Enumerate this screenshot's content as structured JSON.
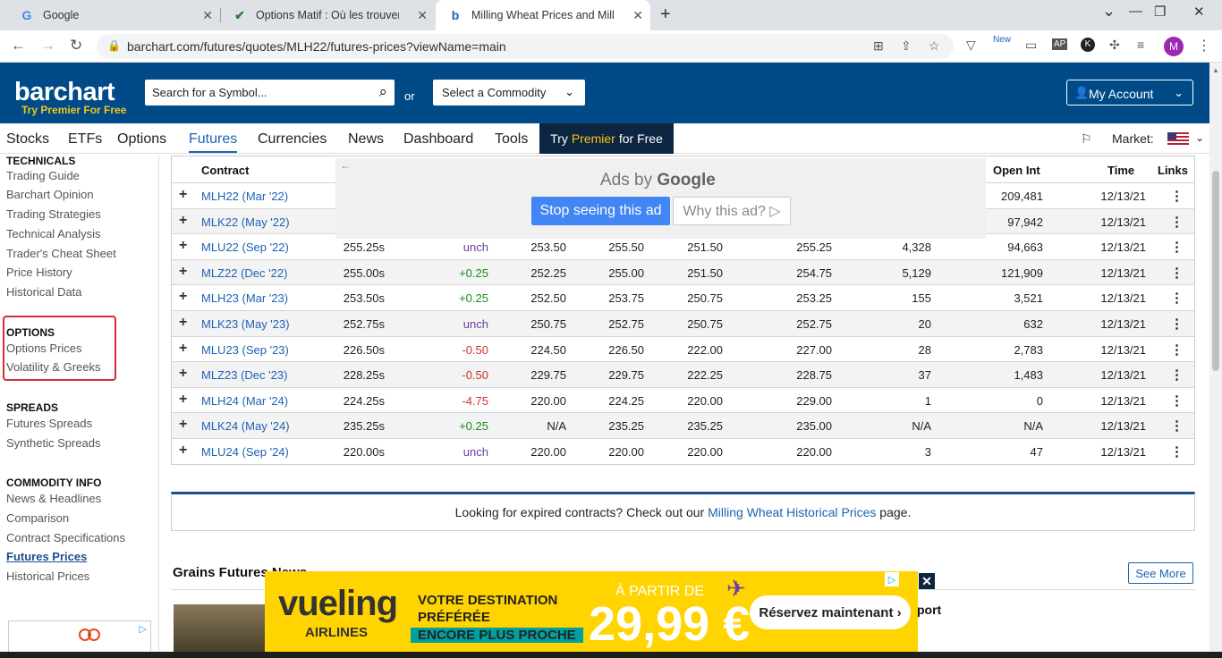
{
  "browser": {
    "tabs": [
      {
        "label": "Google",
        "favicon": "G"
      },
      {
        "label": "Options Matif : Où les trouver? -",
        "favicon": "✔"
      },
      {
        "label": "Milling Wheat Prices and Milling",
        "favicon": "b"
      }
    ],
    "url": "barchart.com/futures/quotes/MLH22/futures-prices?viewName=main",
    "avatar": "M",
    "ext_new_badge": "New",
    "ext_ap": "AP",
    "ext_k": "K"
  },
  "header": {
    "logo": "barchart",
    "premier_tag": "Try Premier For Free",
    "search_placeholder": "Search for a Symbol...",
    "or": "or",
    "commodity_placeholder": "Select a Commodity",
    "account": "My Account"
  },
  "nav": {
    "items": [
      "Stocks",
      "ETFs",
      "Options",
      "Futures",
      "Currencies",
      "News",
      "Dashboard",
      "Tools"
    ],
    "try": "Try",
    "premier": "Premier",
    "for_free": "for Free",
    "market": "Market:"
  },
  "sidebar": {
    "technicals": "TECHNICALS",
    "tech_links": [
      "Trading Guide",
      "Barchart Opinion",
      "Trading Strategies",
      "Technical Analysis",
      "Trader's Cheat Sheet",
      "Price History",
      "Historical Data"
    ],
    "options": "OPTIONS",
    "options_links": [
      "Options Prices",
      "Volatility & Greeks"
    ],
    "spreads": "SPREADS",
    "spreads_links": [
      "Futures Spreads",
      "Synthetic Spreads"
    ],
    "commodity": "COMMODITY INFO",
    "commodity_links": [
      "News & Headlines",
      "Comparison",
      "Contract Specifications",
      "Futures Prices",
      "Historical Prices"
    ],
    "ad_choices": "▷"
  },
  "table": {
    "headers": {
      "contract": "Contract",
      "open_int": "Open Int",
      "time": "Time",
      "links": "Links"
    },
    "rows": [
      {
        "contract": "MLH22 (Mar '22)",
        "last": "",
        "change": "",
        "open": "",
        "high": "",
        "low": "",
        "prev": "",
        "volume": "",
        "open_int": "209,481",
        "time": "12/13/21"
      },
      {
        "contract": "MLK22 (May '22)",
        "last": "",
        "change": "",
        "open": "",
        "high": "",
        "low": "",
        "prev": "",
        "volume": "",
        "open_int": "97,942",
        "time": "12/13/21"
      },
      {
        "contract": "MLU22 (Sep '22)",
        "last": "255.25s",
        "change": "unch",
        "open": "253.50",
        "high": "255.50",
        "low": "251.50",
        "prev": "255.25",
        "volume": "4,328",
        "open_int": "94,663",
        "time": "12/13/21"
      },
      {
        "contract": "MLZ22 (Dec '22)",
        "last": "255.00s",
        "change": "+0.25",
        "open": "252.25",
        "high": "255.00",
        "low": "251.50",
        "prev": "254.75",
        "volume": "5,129",
        "open_int": "121,909",
        "time": "12/13/21"
      },
      {
        "contract": "MLH23 (Mar '23)",
        "last": "253.50s",
        "change": "+0.25",
        "open": "252.50",
        "high": "253.75",
        "low": "250.75",
        "prev": "253.25",
        "volume": "155",
        "open_int": "3,521",
        "time": "12/13/21"
      },
      {
        "contract": "MLK23 (May '23)",
        "last": "252.75s",
        "change": "unch",
        "open": "250.75",
        "high": "252.75",
        "low": "250.75",
        "prev": "252.75",
        "volume": "20",
        "open_int": "632",
        "time": "12/13/21"
      },
      {
        "contract": "MLU23 (Sep '23)",
        "last": "226.50s",
        "change": "-0.50",
        "open": "224.50",
        "high": "226.50",
        "low": "222.00",
        "prev": "227.00",
        "volume": "28",
        "open_int": "2,783",
        "time": "12/13/21"
      },
      {
        "contract": "MLZ23 (Dec '23)",
        "last": "228.25s",
        "change": "-0.50",
        "open": "229.75",
        "high": "229.75",
        "low": "222.25",
        "prev": "228.75",
        "volume": "37",
        "open_int": "1,483",
        "time": "12/13/21"
      },
      {
        "contract": "MLH24 (Mar '24)",
        "last": "224.25s",
        "change": "-4.75",
        "open": "220.00",
        "high": "224.25",
        "low": "220.00",
        "prev": "229.00",
        "volume": "1",
        "open_int": "0",
        "time": "12/13/21"
      },
      {
        "contract": "MLK24 (May '24)",
        "last": "235.25s",
        "change": "+0.25",
        "open": "N/A",
        "high": "235.25",
        "low": "235.25",
        "prev": "235.00",
        "volume": "N/A",
        "open_int": "N/A",
        "time": "12/13/21"
      },
      {
        "contract": "MLU24 (Sep '24)",
        "last": "220.00s",
        "change": "unch",
        "open": "220.00",
        "high": "220.00",
        "low": "220.00",
        "prev": "220.00",
        "volume": "3",
        "open_int": "47",
        "time": "12/13/21"
      }
    ]
  },
  "google_ad": {
    "ads_by": "Ads by",
    "google": "Google",
    "stop": "Stop seeing this ad",
    "why": "Why this ad? ▷"
  },
  "expired": {
    "before": "Looking for expired contracts? Check out our ",
    "link": "Milling Wheat Historical Prices",
    "after": " page."
  },
  "news": {
    "heading": "Grains Futures News",
    "see_more": "See More",
    "title_fragment": "port"
  },
  "vueling_ad": {
    "logo": "vueling",
    "airlines": "AIRLINES",
    "line1": "VOTRE DESTINATION",
    "line2": "PRÉFÉRÉE",
    "line3": "ENCORE PLUS PROCHE",
    "a_partir": "À PARTIR DE",
    "price": "29,99 €",
    "cta": "Réservez maintenant"
  }
}
